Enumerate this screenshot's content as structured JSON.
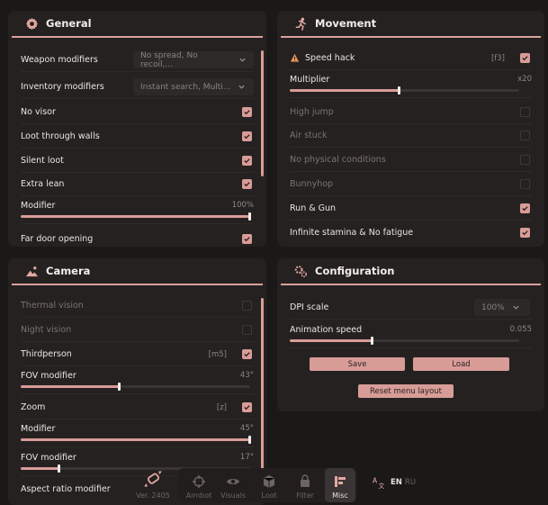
{
  "general": {
    "title": "General",
    "weapon_modifiers": {
      "label": "Weapon modifiers",
      "value": "No spread, No recoil,..."
    },
    "inventory_modifiers": {
      "label": "Inventory modifiers",
      "value": "Instant search, Multi..."
    },
    "no_visor": {
      "label": "No visor",
      "checked": true
    },
    "loot_through_walls": {
      "label": "Loot through walls",
      "checked": true
    },
    "silent_loot": {
      "label": "Silent loot",
      "checked": true
    },
    "extra_lean": {
      "label": "Extra lean",
      "checked": true
    },
    "modifier": {
      "label": "Modifier",
      "value": "100%",
      "level": 1.0
    },
    "far_door_opening": {
      "label": "Far door opening",
      "checked": true
    }
  },
  "movement": {
    "title": "Movement",
    "speed_hack": {
      "label": "Speed hack",
      "key": "[f3]",
      "checked": true
    },
    "multiplier": {
      "label": "Multiplier",
      "value": "x20",
      "level": 0.48
    },
    "high_jump": {
      "label": "High jump",
      "checked": false
    },
    "air_stuck": {
      "label": "Air stuck",
      "checked": false
    },
    "no_physical": {
      "label": "No physical conditions",
      "checked": false
    },
    "bunnyhop": {
      "label": "Bunnyhop",
      "checked": false
    },
    "run_gun": {
      "label": "Run & Gun",
      "checked": true
    },
    "infinite_stamina": {
      "label": "Infinite stamina & No fatigue",
      "checked": true
    }
  },
  "camera": {
    "title": "Camera",
    "thermal": {
      "label": "Thermal vision",
      "checked": false
    },
    "night": {
      "label": "Night vision",
      "checked": false
    },
    "thirdperson": {
      "label": "Thirdperson",
      "key": "[m5]",
      "checked": true
    },
    "fov_modifier": {
      "label": "FOV modifier",
      "value": "43°",
      "level": 0.43
    },
    "zoom": {
      "label": "Zoom",
      "key": "[z]",
      "checked": true
    },
    "zoom_modifier": {
      "label": "Modifier",
      "value": "45°",
      "level": 1.0
    },
    "zoom_fov": {
      "label": "FOV modifier",
      "value": "17°",
      "level": 0.17
    },
    "aspect": {
      "label": "Aspect ratio modifier"
    }
  },
  "configuration": {
    "title": "Configuration",
    "dpi": {
      "label": "DPI scale",
      "value": "100%"
    },
    "animation_speed": {
      "label": "Animation speed",
      "value": "0.055",
      "level": 0.36
    },
    "save": "Save",
    "load": "Load",
    "reset": "Reset menu layout"
  },
  "dock": {
    "version": "Ver. 2405",
    "aimbot": "Aimbot",
    "visuals": "Visuals",
    "loot": "Loot",
    "filter": "Filter",
    "misc": "Misc",
    "lang_en": "EN",
    "lang_ru": "RU"
  },
  "colors": {
    "accent": "#d89c97",
    "panel": "#252121",
    "background": "#1b1818"
  }
}
